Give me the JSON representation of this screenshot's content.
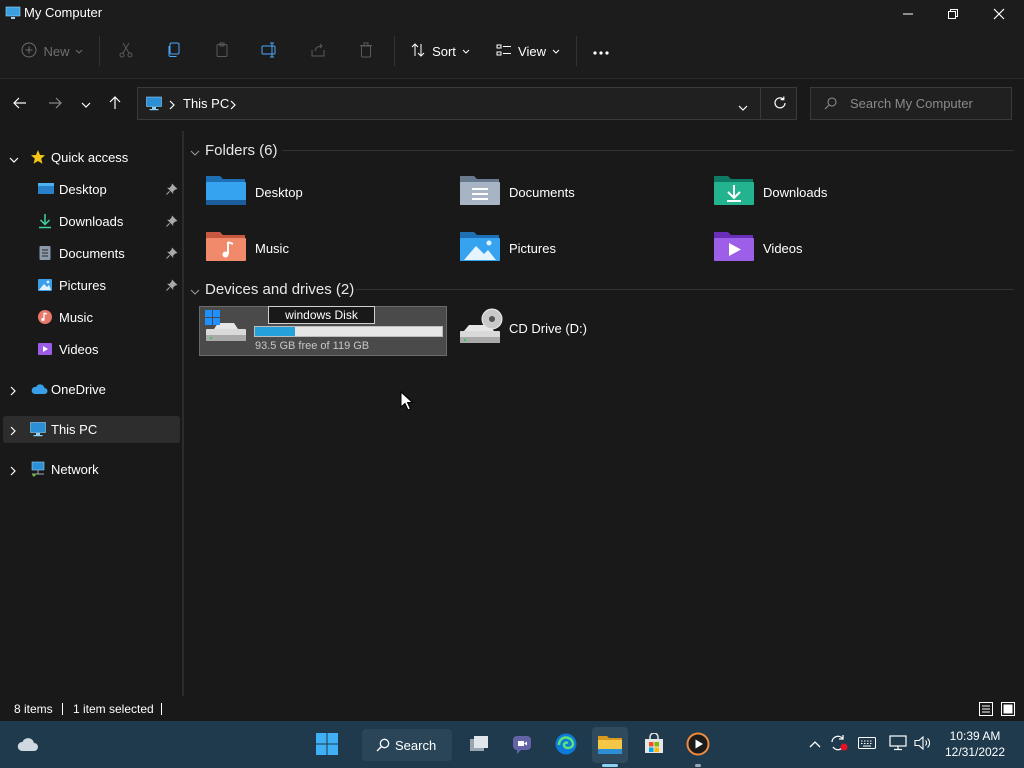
{
  "window": {
    "title": "My Computer"
  },
  "toolbar": {
    "new_label": "New",
    "sort_label": "Sort",
    "view_label": "View"
  },
  "address": {
    "location": "This PC",
    "search_placeholder": "Search My Computer"
  },
  "sidebar": {
    "quick_access": "Quick access",
    "pinned": [
      "Desktop",
      "Downloads",
      "Documents",
      "Pictures"
    ],
    "unpinned": [
      "Music",
      "Videos"
    ],
    "onedrive": "OneDrive",
    "this_pc": "This PC",
    "network": "Network"
  },
  "folders": {
    "header": "Folders (6)",
    "items": [
      "Desktop",
      "Documents",
      "Downloads",
      "Music",
      "Pictures",
      "Videos"
    ]
  },
  "drives": {
    "header": "Devices and drives (2)",
    "items": [
      {
        "name": "windows Disk",
        "free_text": "93.5 GB free of 119 GB",
        "used_fraction": 0.214
      },
      {
        "name": "CD Drive (D:)"
      }
    ]
  },
  "statusbar": {
    "items": "8 items",
    "selected": "1 item selected"
  },
  "taskbar": {
    "search_label": "Search",
    "time": "10:39 AM",
    "date": "12/31/2022"
  },
  "colors": {
    "accent": "#0078d4",
    "taskbar": "#1f3a4c",
    "background": "#191919",
    "selection": "#4a4a4a"
  }
}
